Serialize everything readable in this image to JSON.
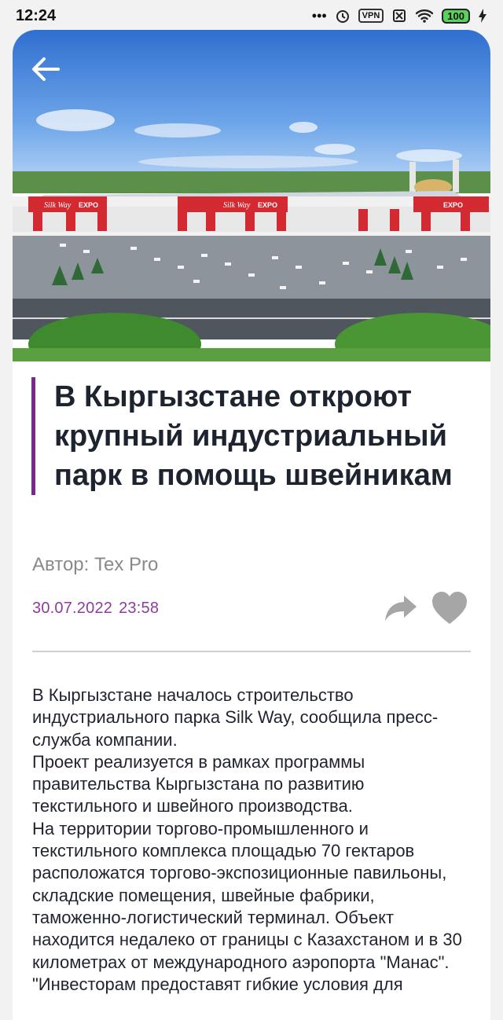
{
  "status_bar": {
    "time": "12:24",
    "dots": "•••",
    "vpn": "VPN",
    "battery": "100"
  },
  "article": {
    "title": "В Кыргызстане откроют крупный индустриальный парк в помощь швейникам",
    "author": "Автор: Tex Pro",
    "date": "30.07.2022",
    "time": "23:58",
    "hero_sign_left": "Silk Way",
    "hero_sign_expo": "EXPO",
    "paragraphs": [
      "В Кыргызстане началось строительство индустриального парка Silk Way, сообщила пресс-служба компании.",
      "Проект реализуется в рамках программы правительства Кыргызстана по развитию текстильного и швейного производства.",
      "На территории торгово-промышленного и текстильного комплекса площадью 70 гектаров расположатся торгово-экспозиционные павильоны, складские помещения, швейные фабрики, таможенно-логистический терминал. Объект находится недалеко от границы с Казахстаном и в 30 километрах от международного аэропорта \"Манас\".",
      "\"Инвесторам предоставят гибкие условия для"
    ]
  },
  "colors": {
    "accent": "#7a2a8c",
    "date": "#8e3d9e",
    "icon_gray": "#a6a6a6"
  },
  "icons": {
    "back": "arrow-left-icon",
    "share": "share-arrow-icon",
    "like": "heart-icon"
  }
}
